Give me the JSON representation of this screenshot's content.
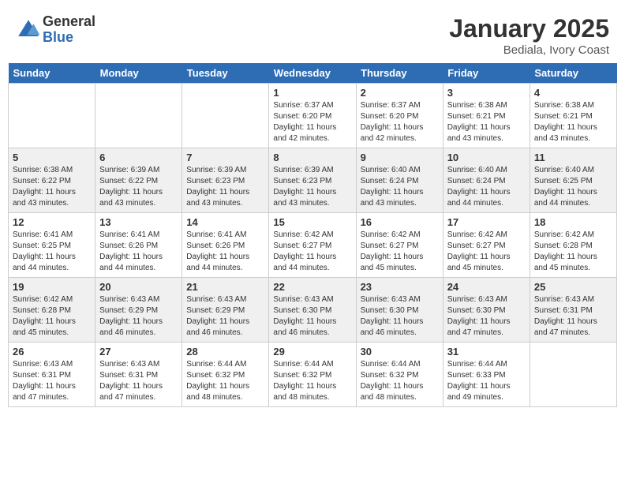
{
  "logo": {
    "general": "General",
    "blue": "Blue"
  },
  "title": {
    "month": "January 2025",
    "location": "Bediala, Ivory Coast"
  },
  "weekdays": [
    "Sunday",
    "Monday",
    "Tuesday",
    "Wednesday",
    "Thursday",
    "Friday",
    "Saturday"
  ],
  "weeks": [
    [
      {
        "day": "",
        "info": ""
      },
      {
        "day": "",
        "info": ""
      },
      {
        "day": "",
        "info": ""
      },
      {
        "day": "1",
        "info": "Sunrise: 6:37 AM\nSunset: 6:20 PM\nDaylight: 11 hours and 42 minutes."
      },
      {
        "day": "2",
        "info": "Sunrise: 6:37 AM\nSunset: 6:20 PM\nDaylight: 11 hours and 42 minutes."
      },
      {
        "day": "3",
        "info": "Sunrise: 6:38 AM\nSunset: 6:21 PM\nDaylight: 11 hours and 43 minutes."
      },
      {
        "day": "4",
        "info": "Sunrise: 6:38 AM\nSunset: 6:21 PM\nDaylight: 11 hours and 43 minutes."
      }
    ],
    [
      {
        "day": "5",
        "info": "Sunrise: 6:38 AM\nSunset: 6:22 PM\nDaylight: 11 hours and 43 minutes."
      },
      {
        "day": "6",
        "info": "Sunrise: 6:39 AM\nSunset: 6:22 PM\nDaylight: 11 hours and 43 minutes."
      },
      {
        "day": "7",
        "info": "Sunrise: 6:39 AM\nSunset: 6:23 PM\nDaylight: 11 hours and 43 minutes."
      },
      {
        "day": "8",
        "info": "Sunrise: 6:39 AM\nSunset: 6:23 PM\nDaylight: 11 hours and 43 minutes."
      },
      {
        "day": "9",
        "info": "Sunrise: 6:40 AM\nSunset: 6:24 PM\nDaylight: 11 hours and 43 minutes."
      },
      {
        "day": "10",
        "info": "Sunrise: 6:40 AM\nSunset: 6:24 PM\nDaylight: 11 hours and 44 minutes."
      },
      {
        "day": "11",
        "info": "Sunrise: 6:40 AM\nSunset: 6:25 PM\nDaylight: 11 hours and 44 minutes."
      }
    ],
    [
      {
        "day": "12",
        "info": "Sunrise: 6:41 AM\nSunset: 6:25 PM\nDaylight: 11 hours and 44 minutes."
      },
      {
        "day": "13",
        "info": "Sunrise: 6:41 AM\nSunset: 6:26 PM\nDaylight: 11 hours and 44 minutes."
      },
      {
        "day": "14",
        "info": "Sunrise: 6:41 AM\nSunset: 6:26 PM\nDaylight: 11 hours and 44 minutes."
      },
      {
        "day": "15",
        "info": "Sunrise: 6:42 AM\nSunset: 6:27 PM\nDaylight: 11 hours and 44 minutes."
      },
      {
        "day": "16",
        "info": "Sunrise: 6:42 AM\nSunset: 6:27 PM\nDaylight: 11 hours and 45 minutes."
      },
      {
        "day": "17",
        "info": "Sunrise: 6:42 AM\nSunset: 6:27 PM\nDaylight: 11 hours and 45 minutes."
      },
      {
        "day": "18",
        "info": "Sunrise: 6:42 AM\nSunset: 6:28 PM\nDaylight: 11 hours and 45 minutes."
      }
    ],
    [
      {
        "day": "19",
        "info": "Sunrise: 6:42 AM\nSunset: 6:28 PM\nDaylight: 11 hours and 45 minutes."
      },
      {
        "day": "20",
        "info": "Sunrise: 6:43 AM\nSunset: 6:29 PM\nDaylight: 11 hours and 46 minutes."
      },
      {
        "day": "21",
        "info": "Sunrise: 6:43 AM\nSunset: 6:29 PM\nDaylight: 11 hours and 46 minutes."
      },
      {
        "day": "22",
        "info": "Sunrise: 6:43 AM\nSunset: 6:30 PM\nDaylight: 11 hours and 46 minutes."
      },
      {
        "day": "23",
        "info": "Sunrise: 6:43 AM\nSunset: 6:30 PM\nDaylight: 11 hours and 46 minutes."
      },
      {
        "day": "24",
        "info": "Sunrise: 6:43 AM\nSunset: 6:30 PM\nDaylight: 11 hours and 47 minutes."
      },
      {
        "day": "25",
        "info": "Sunrise: 6:43 AM\nSunset: 6:31 PM\nDaylight: 11 hours and 47 minutes."
      }
    ],
    [
      {
        "day": "26",
        "info": "Sunrise: 6:43 AM\nSunset: 6:31 PM\nDaylight: 11 hours and 47 minutes."
      },
      {
        "day": "27",
        "info": "Sunrise: 6:43 AM\nSunset: 6:31 PM\nDaylight: 11 hours and 47 minutes."
      },
      {
        "day": "28",
        "info": "Sunrise: 6:44 AM\nSunset: 6:32 PM\nDaylight: 11 hours and 48 minutes."
      },
      {
        "day": "29",
        "info": "Sunrise: 6:44 AM\nSunset: 6:32 PM\nDaylight: 11 hours and 48 minutes."
      },
      {
        "day": "30",
        "info": "Sunrise: 6:44 AM\nSunset: 6:32 PM\nDaylight: 11 hours and 48 minutes."
      },
      {
        "day": "31",
        "info": "Sunrise: 6:44 AM\nSunset: 6:33 PM\nDaylight: 11 hours and 49 minutes."
      },
      {
        "day": "",
        "info": ""
      }
    ]
  ]
}
